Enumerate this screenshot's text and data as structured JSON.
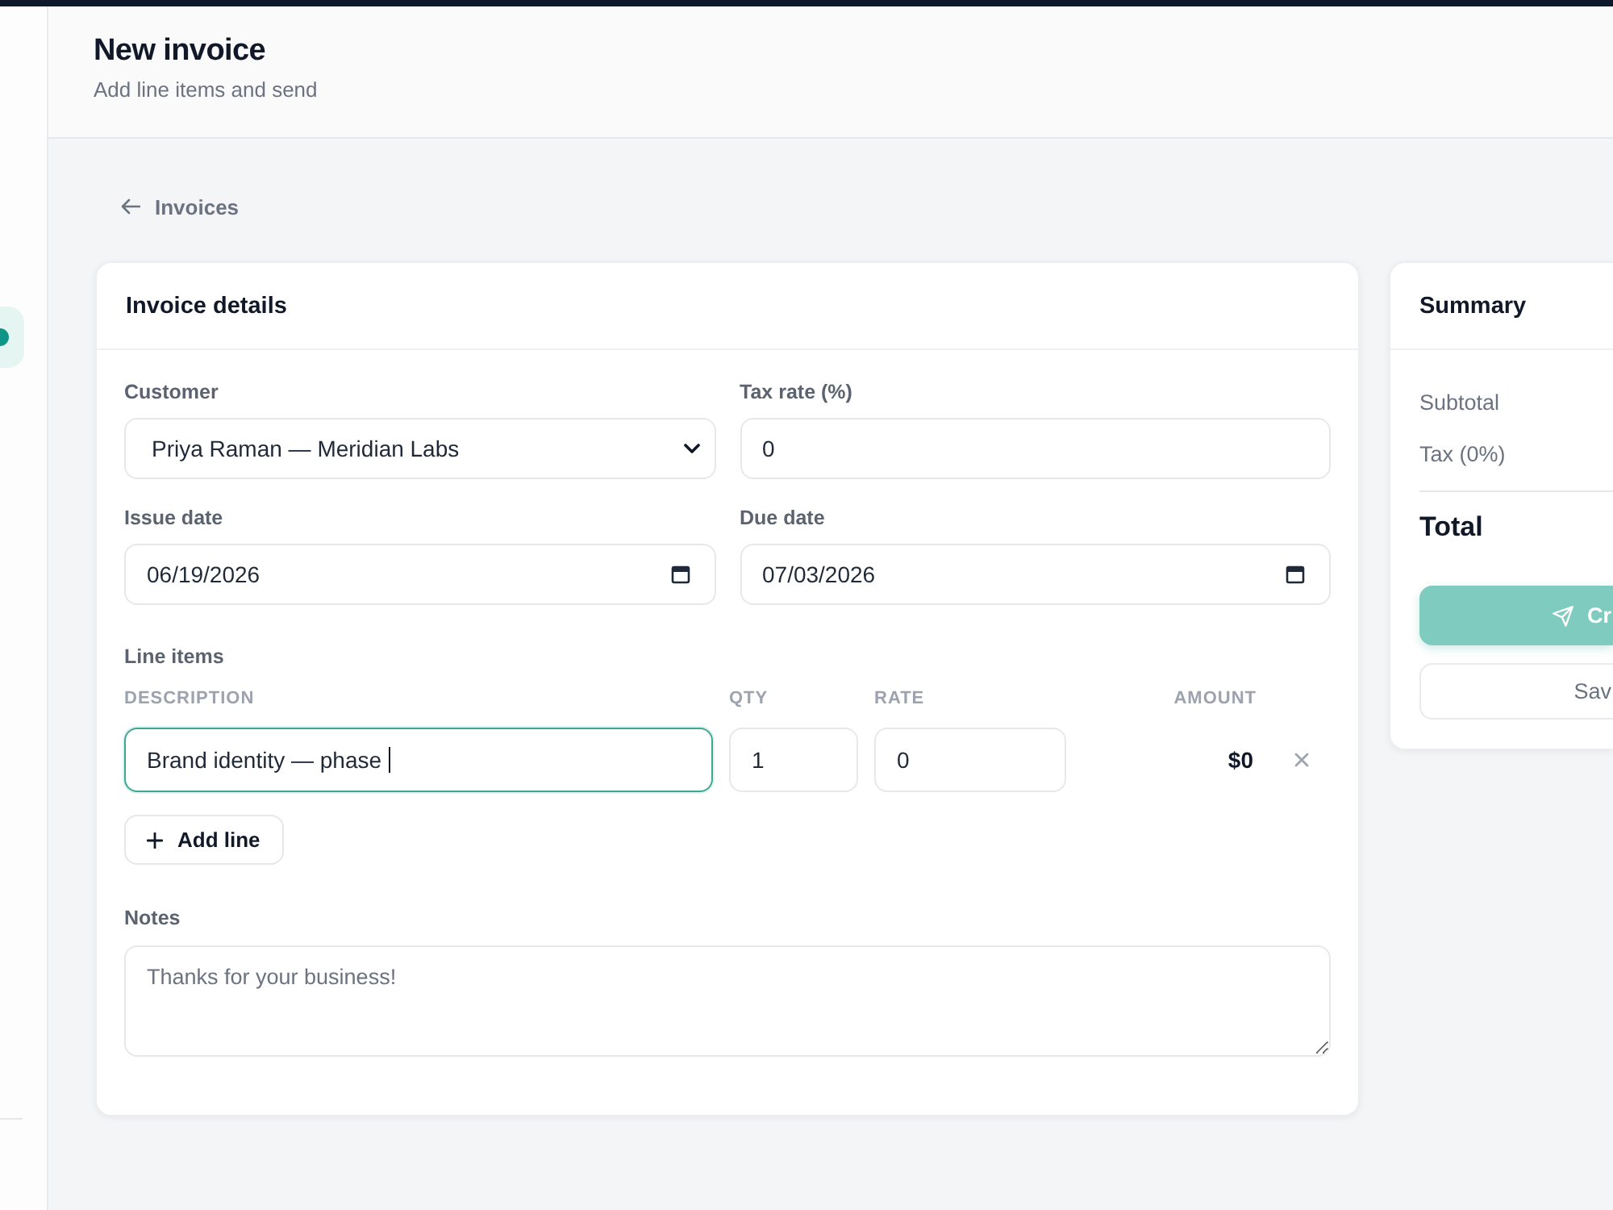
{
  "sidebar": {
    "items": [
      {
        "selected": true
      }
    ]
  },
  "header": {
    "title": "New invoice",
    "subtitle": "Add line items and send"
  },
  "back_link": {
    "label": "Invoices"
  },
  "invoice_details": {
    "title": "Invoice details",
    "fields": [
      {
        "kind": "select",
        "label": "Customer",
        "value": "Priya Raman — Meridian Labs"
      },
      {
        "kind": "number",
        "label": "Tax rate (%)",
        "value": "0"
      },
      {
        "kind": "date",
        "label": "Issue date",
        "value": "06/19/2026"
      },
      {
        "kind": "date",
        "label": "Due date",
        "value": "07/03/2026"
      }
    ],
    "line_items": {
      "label": "Line items",
      "columns": [
        "DESCRIPTION",
        "QTY",
        "RATE",
        "AMOUNT"
      ],
      "rows": [
        {
          "description": "Brand identity — phase",
          "focused": true,
          "qty": "1",
          "rate": "0",
          "amount": "$0"
        }
      ],
      "add_button": "Add line"
    },
    "notes": {
      "label": "Notes",
      "placeholder": "Thanks for your business!"
    }
  },
  "summary": {
    "title": "Summary",
    "rows": [
      {
        "kind": "line",
        "label": "Subtotal"
      },
      {
        "kind": "line",
        "label": "Tax (0%)"
      },
      {
        "kind": "total",
        "label": "Total"
      }
    ],
    "buttons": [
      {
        "kind": "primary",
        "label": "Cr",
        "disabled": true
      },
      {
        "kind": "secondary",
        "label": "Sav"
      }
    ]
  }
}
